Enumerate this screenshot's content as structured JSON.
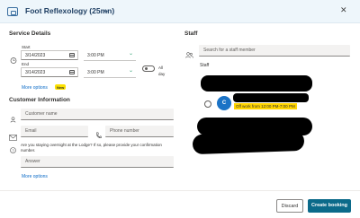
{
  "header": {
    "title": "Foot Reflexology (25mn)"
  },
  "service": {
    "section_title": "Service Details",
    "start_label": "Start",
    "end_label": "End",
    "start_date": "3/14/2023",
    "start_time": "3:00 PM",
    "end_date": "3/14/2023",
    "end_time": "3:00 PM",
    "all_day_line1": "All",
    "all_day_line2": "day",
    "more_options": "More options",
    "new_badge": "New"
  },
  "customer": {
    "section_title": "Customer Information",
    "name_placeholder": "Customer name",
    "email_placeholder": "Email",
    "phone_placeholder": "Phone number",
    "question": "Are you staying overnight at the Lodge? If so, please provide your confirmation number.",
    "answer_placeholder": "Answer",
    "more_options": "More options"
  },
  "staff": {
    "section_title": "Staff",
    "search_placeholder": "Search for a staff member",
    "list_label": "Staff",
    "avatar_initial": "C",
    "off_work": "Off work from 12:00 PM-7:00 PM"
  },
  "footer": {
    "discard": "Discard",
    "create": "Create booking"
  },
  "colors": {
    "accent": "#0b6a8a",
    "link": "#0b6bc7",
    "avatar": "#1b73c6",
    "highlight": "#ffd400",
    "time_chevron": "#2a9d6f"
  }
}
